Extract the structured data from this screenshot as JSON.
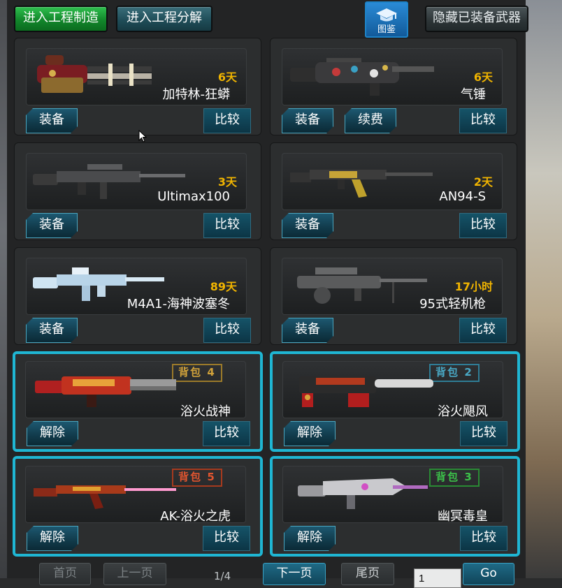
{
  "toolbar": {
    "craft_label": "进入工程制造",
    "disassemble_label": "进入工程分解",
    "catalog_label": "图鉴",
    "hide_equipped_label": "隐藏已装备武器"
  },
  "colors": {
    "accent_cyan": "#1fb6d3",
    "days_gold": "#f0b400",
    "bag4": "#d1a23a",
    "bag2": "#49a9c6",
    "bag5": "#e0552f",
    "bag3": "#3cc24a"
  },
  "cards": [
    {
      "name": "加特林-狂蟒",
      "days": "6天",
      "btn1": "装备",
      "compare": "比较"
    },
    {
      "name": "气锤",
      "days": "6天",
      "btn1": "装备",
      "btn2": "续费",
      "compare": "比较"
    },
    {
      "name": "Ultimax100",
      "days": "3天",
      "btn1": "装备",
      "compare": "比较"
    },
    {
      "name": "AN94-S",
      "days": "2天",
      "btn1": "装备",
      "compare": "比较"
    },
    {
      "name": "M4A1-海神波塞冬",
      "days": "89天",
      "btn1": "装备",
      "compare": "比较"
    },
    {
      "name": "95式轻机枪",
      "days": "17小时",
      "btn1": "装备",
      "compare": "比较"
    },
    {
      "name": "浴火战神",
      "bag": "背包 4",
      "btn1": "解除",
      "compare": "比较"
    },
    {
      "name": "浴火飓风",
      "bag": "背包 2",
      "btn1": "解除",
      "compare": "比较"
    },
    {
      "name": "AK-浴火之虎",
      "bag": "背包 5",
      "btn1": "解除",
      "compare": "比较"
    },
    {
      "name": "幽冥毒皇",
      "bag": "背包 3",
      "btn1": "解除",
      "compare": "比较"
    }
  ],
  "pagination": {
    "first": "首页",
    "prev": "上一页",
    "info": "1/4",
    "next": "下一页",
    "last": "尾页",
    "page_value": "1",
    "go": "Go"
  }
}
